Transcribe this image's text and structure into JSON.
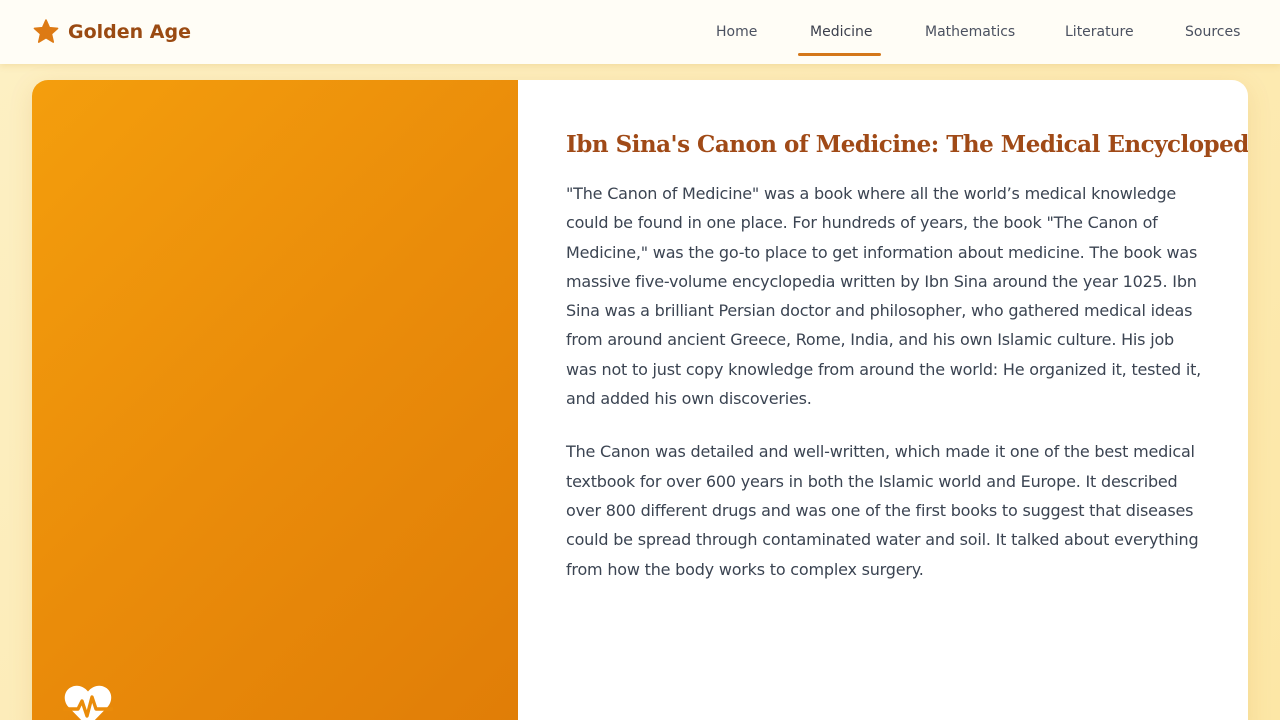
{
  "brand": {
    "name": "Golden Age",
    "icon": "star-icon"
  },
  "nav": {
    "items": [
      {
        "label": "Home",
        "active": false
      },
      {
        "label": "Medicine",
        "active": true
      },
      {
        "label": "Mathematics",
        "active": false
      },
      {
        "label": "Literature",
        "active": false
      },
      {
        "label": "Sources",
        "active": false
      }
    ]
  },
  "article": {
    "image_icon": "heartbeat-icon",
    "title": "Ibn Sina's Canon of Medicine: The Medical Encyclopedia",
    "paragraphs": [
      "\"The Canon of Medicine\" was a book where all the world’s medical knowledge could be found in one place. For hundreds of years, the book \"The Canon of Medicine,\" was the go-to place to get information about medicine. The book was massive five-volume encyclopedia written by Ibn Sina around the year 1025. Ibn Sina was a brilliant Persian doctor and philosopher, who gathered medical ideas from around ancient Greece, Rome, India, and his own Islamic culture. His job was not to just copy knowledge from around the world: He organized it, tested it, and added his own discoveries.",
      "The Canon was detailed and well-written, which made it one of the best medical textbook for over 600 years in both the Islamic world and Europe. It described over 800 different drugs and was one of the first books to suggest that diseases could be spread through contaminated water and soil. It talked about everything from how the body works to complex surgery."
    ]
  },
  "colors": {
    "brand": "#9a4a12",
    "accent": "#d4771a",
    "title": "#a04a17",
    "body_text": "#3b4452",
    "image_gradient_start": "#f49e0d",
    "image_gradient_end": "#e07d07"
  }
}
